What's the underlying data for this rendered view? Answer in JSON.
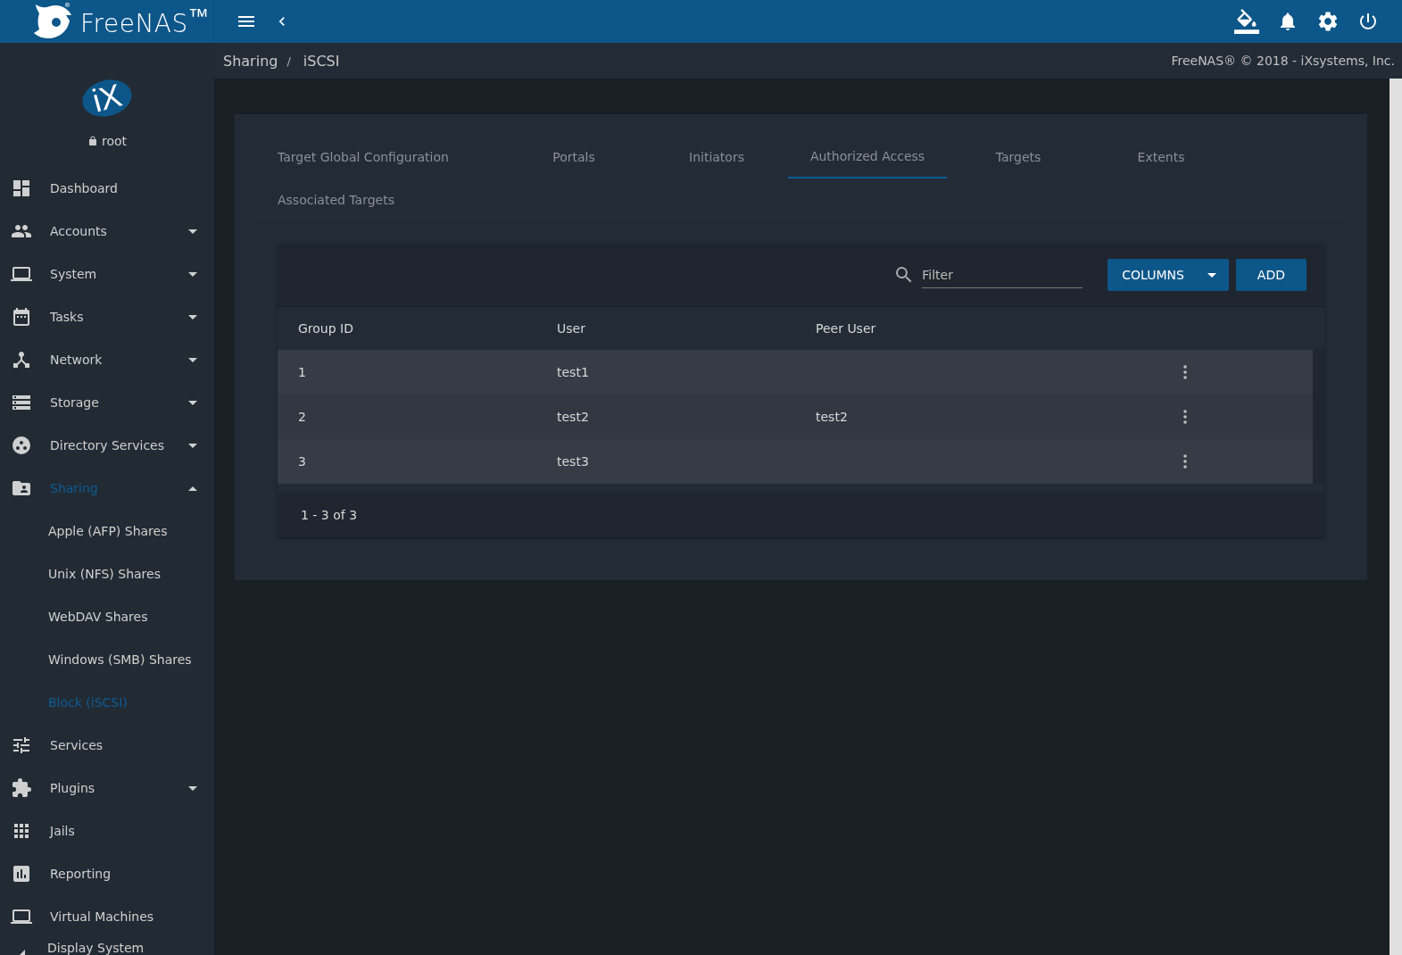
{
  "topbar": {
    "brand": "FreeNAS$^{™}$",
    "brand_mark": "®"
  },
  "breadcrumb": {
    "items": [
      "Sharing",
      "iSCSI"
    ],
    "separator": "/"
  },
  "copyright": "FreeNAS® © 2018 - iXsystems, Inc.",
  "sidebar": {
    "logo": "iX",
    "user": "root",
    "items": [
      {
        "label": "Dashboard",
        "selected": false
      },
      {
        "label": "Accounts",
        "selected": false,
        "expanded": false
      },
      {
        "label": "System",
        "selected": false,
        "expanded": false
      },
      {
        "label": "Tasks",
        "selected": false,
        "expanded": false
      },
      {
        "label": "Network",
        "selected": false,
        "expanded": false
      },
      {
        "label": "Storage",
        "selected": false,
        "expanded": false
      },
      {
        "label": "Directory Services",
        "selected": false,
        "expanded": false
      },
      {
        "label": "Sharing",
        "selected": true,
        "expanded": true,
        "children": [
          {
            "label": "Apple (AFP) Shares",
            "selected": false
          },
          {
            "label": "Unix (NFS) Shares",
            "selected": false
          },
          {
            "label": "WebDAV Shares",
            "selected": false
          },
          {
            "label": "Windows (SMB) Shares",
            "selected": false
          },
          {
            "label": "Block (iSCSI)",
            "selected": true
          }
        ]
      },
      {
        "label": "Services",
        "selected": false
      },
      {
        "label": "Plugins",
        "selected": false,
        "expanded": false
      },
      {
        "label": "Jails",
        "selected": false
      },
      {
        "label": "Reporting",
        "selected": false
      },
      {
        "label": "Virtual Machines",
        "selected": false
      },
      {
        "label": "Display System",
        "selected": false
      }
    ]
  },
  "tabs": [
    {
      "label": "Target Global Configuration",
      "selected": false
    },
    {
      "label": "Portals",
      "selected": false
    },
    {
      "label": "Initiators",
      "selected": false
    },
    {
      "label": "Authorized Access",
      "selected": true
    },
    {
      "label": "Targets",
      "selected": false
    },
    {
      "label": "Extents",
      "selected": false
    },
    {
      "label": "Associated Targets",
      "selected": false
    }
  ],
  "table": {
    "filter": {
      "placeholder": "Filter"
    },
    "columns_button": "COLUMNS",
    "add_button": "ADD",
    "columns": [
      "Group ID",
      "User",
      "Peer User"
    ],
    "rows": [
      {
        "cells": [
          "1",
          "test1",
          ""
        ]
      },
      {
        "cells": [
          "2",
          "test2",
          "test2"
        ]
      },
      {
        "cells": [
          "3",
          "test3",
          ""
        ]
      }
    ],
    "pagination": "1 - 3 of 3"
  }
}
